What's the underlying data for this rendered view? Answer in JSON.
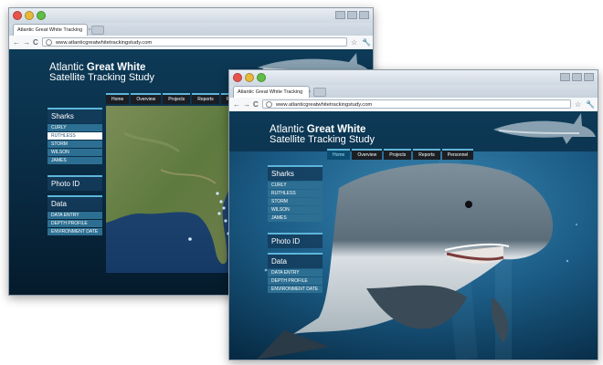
{
  "browser": {
    "tab_title": "Atlantic Great White Tracking",
    "tab_close": "×",
    "url": "www.atlanticgreatwhitetrackingstudy.com",
    "back": "←",
    "forward": "→",
    "reload": "C",
    "star": "☆",
    "menu": "🔧"
  },
  "site": {
    "brand_regular": "Atlantic",
    "brand_bold": "Great White",
    "brand_line2": "Satellite Tracking Study",
    "nav": [
      "Home",
      "Overview",
      "Projects",
      "Reports",
      "Personnel"
    ],
    "nav_back_partial": "P",
    "sidebar": {
      "sharks_heading": "Sharks",
      "sharks": [
        "CURLY",
        "RUTHLESS",
        "STORM",
        "WILSON",
        "JAMES"
      ],
      "photo_heading": "Photo ID",
      "data_heading": "Data",
      "data_items": [
        "DATA ENTRY",
        "DEPTH PROFILE",
        "ENVIRONMENT DATE"
      ]
    }
  },
  "colors": {
    "accent": "#5db6da",
    "navbar": "#1b1f24",
    "item": "#2d6f92",
    "header_bg": "#0d3a57"
  },
  "icons": [
    "globe-icon",
    "star-icon",
    "wrench-icon",
    "shark-icon"
  ]
}
